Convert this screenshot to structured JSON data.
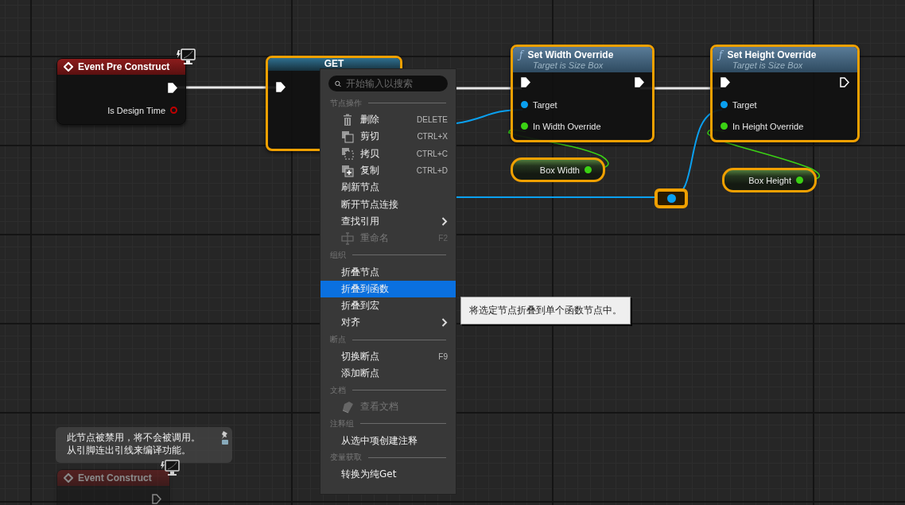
{
  "nodes": [
    {
      "kind": "event",
      "title": "Event Pre Construct",
      "selected": false,
      "disabled": false,
      "exec_out": {
        "connected": true
      },
      "outputs": [
        {
          "color": "#c00000",
          "label": "Is Design Time",
          "connected": false
        }
      ]
    },
    {
      "kind": "get",
      "title": "GET",
      "selected": true,
      "exec_in": {
        "connected": true
      }
    },
    {
      "kind": "function",
      "glyph": "ƒ",
      "title": "Set Width Override",
      "subtitle": "Target is Size Box",
      "selected": true,
      "exec_in": {
        "connected": true
      },
      "exec_out": {
        "connected": true
      },
      "inputs": [
        {
          "color": "#0aa0f0",
          "label": "Target",
          "connected": true
        },
        {
          "color": "#3bd214",
          "label": "In Width Override",
          "connected": true
        }
      ]
    },
    {
      "kind": "getter",
      "label": "Box Width",
      "selected": true,
      "color": "#3bd214"
    },
    {
      "kind": "function",
      "glyph": "ƒ",
      "title": "Set Height Override",
      "subtitle": "Target is Size Box",
      "selected": true,
      "exec_in": {
        "connected": true
      },
      "exec_out": {
        "connected": false
      },
      "inputs": [
        {
          "color": "#0aa0f0",
          "label": "Target",
          "connected": true
        },
        {
          "color": "#3bd214",
          "label": "In Height Override",
          "connected": true
        }
      ]
    },
    {
      "kind": "getter",
      "label": "Box Height",
      "selected": true,
      "color": "#3bd214"
    },
    {
      "kind": "reroute",
      "selected": true,
      "color": "#0aa0f0"
    },
    {
      "kind": "event",
      "title": "Event Construct",
      "selected": false,
      "disabled": true,
      "exec_out": {
        "connected": false
      }
    }
  ],
  "disabled_note": {
    "lines": [
      "此节点被禁用，将不会被调用。",
      "从引脚连出引线来编译功能。"
    ]
  },
  "context_menu": {
    "search": {
      "placeholder": "开始输入以搜索"
    },
    "sections": [
      {
        "heading": "节点操作",
        "items": [
          {
            "kind": "delete",
            "label": "删除",
            "shortcut": "DELETE",
            "disabled": false,
            "selected": false,
            "submenu": false
          },
          {
            "kind": "cut",
            "label": "剪切",
            "shortcut": "CTRL+X",
            "disabled": false,
            "selected": false,
            "submenu": false
          },
          {
            "kind": "copy",
            "label": "拷贝",
            "shortcut": "CTRL+C",
            "disabled": false,
            "selected": false,
            "submenu": false
          },
          {
            "kind": "duplicate",
            "label": "复制",
            "shortcut": "CTRL+D",
            "disabled": false,
            "selected": false,
            "submenu": false
          },
          {
            "kind": "plain",
            "label": "刷新节点",
            "disabled": false,
            "selected": false,
            "submenu": false
          },
          {
            "kind": "plain",
            "label": "断开节点连接",
            "disabled": false,
            "selected": false,
            "submenu": false
          },
          {
            "kind": "plain",
            "label": "查找引用",
            "disabled": false,
            "selected": false,
            "submenu": true
          },
          {
            "kind": "rename",
            "label": "重命名",
            "shortcut": "F2",
            "disabled": true,
            "selected": false,
            "submenu": false
          }
        ]
      },
      {
        "heading": "组织",
        "items": [
          {
            "kind": "plain",
            "label": "折叠节点",
            "disabled": false,
            "selected": false,
            "submenu": false
          },
          {
            "kind": "plain",
            "label": "折叠到函数",
            "disabled": false,
            "selected": true,
            "submenu": false
          },
          {
            "kind": "plain",
            "label": "折叠到宏",
            "disabled": false,
            "selected": false,
            "submenu": false
          },
          {
            "kind": "plain",
            "label": "对齐",
            "disabled": false,
            "selected": false,
            "submenu": true
          }
        ]
      },
      {
        "heading": "断点",
        "items": [
          {
            "kind": "plain",
            "label": "切换断点",
            "shortcut": "F9",
            "disabled": false,
            "selected": false,
            "submenu": false
          },
          {
            "kind": "plain",
            "label": "添加断点",
            "disabled": false,
            "selected": false,
            "submenu": false
          }
        ]
      },
      {
        "heading": "文档",
        "items": [
          {
            "kind": "docs",
            "label": "查看文档",
            "disabled": true,
            "selected": false,
            "submenu": false
          }
        ]
      },
      {
        "heading": "注释组",
        "items": [
          {
            "kind": "plain",
            "label": "从选中项创建注释",
            "disabled": false,
            "selected": false,
            "submenu": false
          }
        ]
      },
      {
        "heading": "变量获取",
        "items": [
          {
            "kind": "plain",
            "label": "转换为纯Get",
            "disabled": false,
            "selected": false,
            "submenu": false
          }
        ]
      }
    ]
  },
  "tooltip": {
    "text": "将选定节点折叠到单个函数节点中。"
  }
}
